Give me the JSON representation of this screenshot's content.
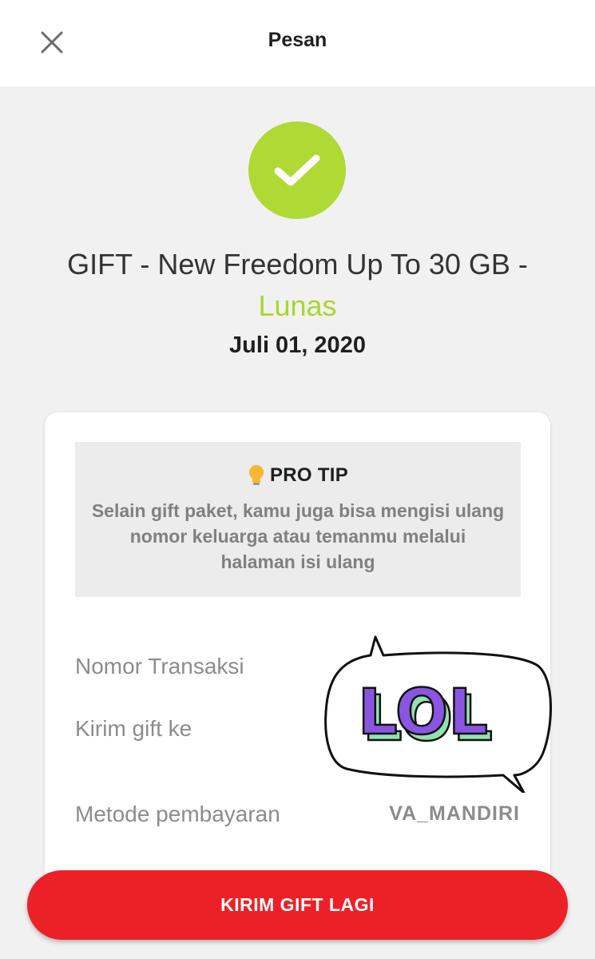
{
  "header": {
    "title": "Pesan",
    "close_icon": "close-icon"
  },
  "status_icon": "check-icon",
  "order": {
    "title": "GIFT - New Freedom Up To 30 GB -",
    "status": "Lunas",
    "date": "Juli 01, 2020"
  },
  "protip": {
    "icon": "lightbulb-icon",
    "title": "PRO TIP",
    "text": "Selain gift paket, kamu juga bisa mengisi ulang nomor keluarga atau temanmu melalui halaman isi ulang"
  },
  "details": {
    "transaction_number_label": "Nomor Transaksi",
    "gift_to_label": "Kirim gift ke",
    "payment_method_label": "Metode pembayaran",
    "payment_method_value": "VA_MANDIRI"
  },
  "sticker": {
    "text": "LOL"
  },
  "cta": {
    "label": "KIRIM GIFT LAGI"
  },
  "colors": {
    "success": "#afd934",
    "status_text": "#a8d62f",
    "cta": "#ec2027",
    "sticker_letters": "#8a55e0",
    "sticker_shadow": "#8fe3b0"
  }
}
